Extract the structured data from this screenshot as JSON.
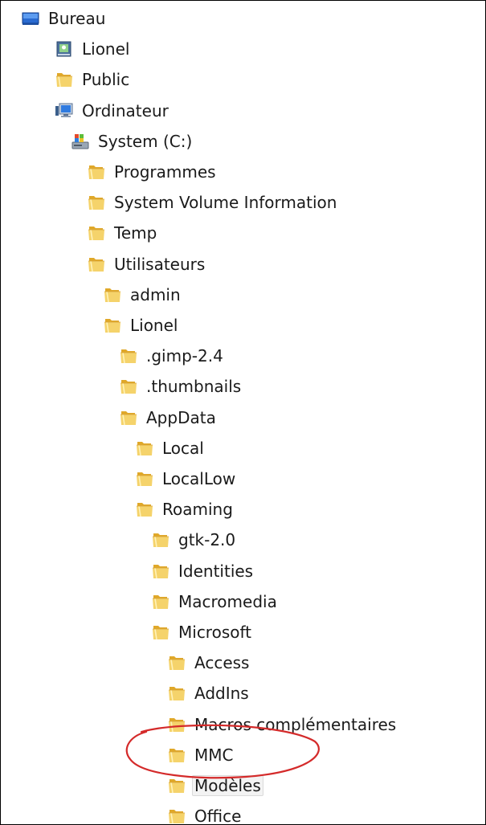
{
  "tree": {
    "items": [
      {
        "label": "Bureau",
        "icon": "desktop-icon",
        "depth": 0
      },
      {
        "label": "Lionel",
        "icon": "user-folder-icon",
        "depth": 1
      },
      {
        "label": "Public",
        "icon": "folder-icon",
        "depth": 1
      },
      {
        "label": "Ordinateur",
        "icon": "computer-icon",
        "depth": 1
      },
      {
        "label": "System (C:)",
        "icon": "drive-icon",
        "depth": 2
      },
      {
        "label": "Programmes",
        "icon": "folder-icon",
        "depth": 3
      },
      {
        "label": "System Volume Information",
        "icon": "folder-icon",
        "depth": 3
      },
      {
        "label": "Temp",
        "icon": "folder-icon",
        "depth": 3
      },
      {
        "label": "Utilisateurs",
        "icon": "folder-icon",
        "depth": 3
      },
      {
        "label": "admin",
        "icon": "folder-icon",
        "depth": 4
      },
      {
        "label": "Lionel",
        "icon": "folder-icon",
        "depth": 4
      },
      {
        "label": ".gimp-2.4",
        "icon": "folder-icon",
        "depth": 5
      },
      {
        "label": ".thumbnails",
        "icon": "folder-icon",
        "depth": 5
      },
      {
        "label": "AppData",
        "icon": "folder-icon",
        "depth": 5
      },
      {
        "label": "Local",
        "icon": "folder-icon",
        "depth": 6
      },
      {
        "label": "LocalLow",
        "icon": "folder-icon",
        "depth": 6
      },
      {
        "label": "Roaming",
        "icon": "folder-icon",
        "depth": 6
      },
      {
        "label": "gtk-2.0",
        "icon": "folder-icon",
        "depth": 7
      },
      {
        "label": "Identities",
        "icon": "folder-icon",
        "depth": 7
      },
      {
        "label": "Macromedia",
        "icon": "folder-icon",
        "depth": 7
      },
      {
        "label": "Microsoft",
        "icon": "folder-icon",
        "depth": 7
      },
      {
        "label": "Access",
        "icon": "folder-icon",
        "depth": 8
      },
      {
        "label": "AddIns",
        "icon": "folder-icon",
        "depth": 8
      },
      {
        "label": "Macros complémentaires",
        "icon": "folder-icon",
        "depth": 8
      },
      {
        "label": "MMC",
        "icon": "folder-icon",
        "depth": 8
      },
      {
        "label": "Modèles",
        "icon": "folder-icon",
        "depth": 8,
        "selected": true
      },
      {
        "label": "Office",
        "icon": "folder-icon",
        "depth": 8
      }
    ]
  },
  "annotation": {
    "shape": "ellipse",
    "color": "#d42a2a",
    "target": "Modèles"
  },
  "colors": {
    "folder_front": "#f5d36b",
    "folder_back": "#e0a829",
    "selection_fill": "#f3f3f3",
    "text": "#1a1a1a"
  }
}
